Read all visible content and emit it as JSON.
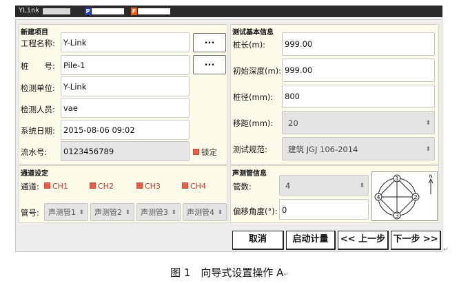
{
  "statusbar": {
    "app": "YLink",
    "tag_p": "P",
    "tag_f": "F",
    "color_p": "#1e3fb8",
    "color_f": "#e2611f"
  },
  "project": {
    "section": "新建项目",
    "project_name": {
      "label": "工程名称:",
      "value": "Y-Link"
    },
    "pile": {
      "label": "桩　　号:",
      "value": "Pile-1"
    },
    "unit": {
      "label": "检测单位:",
      "value": "Y-Link"
    },
    "person": {
      "label": "检测人员:",
      "value": "vae"
    },
    "date": {
      "label": "系统日期:",
      "value": "2015-08-06  09:02"
    },
    "serial": {
      "label": "流水号:",
      "value": "0123456789"
    },
    "lock_label": "锁定",
    "browse_label": "..."
  },
  "basic": {
    "section": "测试基本信息",
    "pile_length": {
      "label": "桩长(m):",
      "value": "999.00"
    },
    "initial_depth": {
      "label": "初始深度(m):",
      "value": "999.00"
    },
    "pile_diameter": {
      "label": "桩径(mm):",
      "value": "800"
    },
    "shift": {
      "label": "移距(mm):",
      "value": "20"
    },
    "standard": {
      "label": "测试规范:",
      "value": "建筑 JGJ 106-2014"
    }
  },
  "channels": {
    "section": "通道设定",
    "label": "通道:",
    "items": [
      "CH1",
      "CH2",
      "CH3",
      "CH4"
    ],
    "pipe_label": "管号:",
    "pipes": [
      "声测管1",
      "声测管2",
      "声测管3",
      "声测管4"
    ]
  },
  "tubes": {
    "section": "声测管信息",
    "count": {
      "label": "管数:",
      "value": "4"
    },
    "offset": {
      "label": "偏移角度(°):",
      "value": "0"
    },
    "diagram": {
      "nodes": [
        "1",
        "2",
        "3",
        "4"
      ],
      "north": "N"
    }
  },
  "buttons": {
    "cancel": "取消",
    "start": "启动计量",
    "prev": "<< 上一步",
    "next": "下一步 >>"
  },
  "caption": "图 1　向导式设置操作 A",
  "accent": {
    "check": "#e2614a",
    "panel_bg": "#fdfbe9"
  }
}
